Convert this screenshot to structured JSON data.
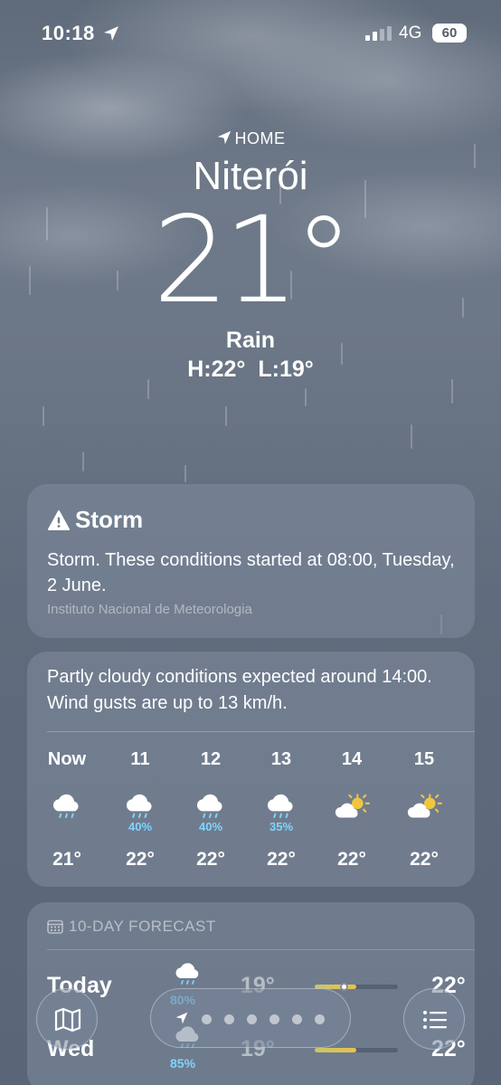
{
  "status_bar": {
    "time": "10:18",
    "network": "4G",
    "battery": "60"
  },
  "header": {
    "location_label": "HOME",
    "city": "Niterói",
    "temperature": "21°",
    "condition": "Rain",
    "high": "H:22°",
    "low": "L:19°"
  },
  "alert": {
    "title": "Storm",
    "text": "Storm. These conditions started at 08:00, Tuesday, 2 June.",
    "source": "Instituto Nacional de Meteorologia"
  },
  "hourly": {
    "summary": "Partly cloudy conditions expected around 14:00. Wind gusts are up to 13 km/h.",
    "hours": [
      {
        "label": "Now",
        "icon": "cloud-rain-icon",
        "pop": "",
        "temp": "21°"
      },
      {
        "label": "11",
        "icon": "cloud-rain-icon",
        "pop": "40%",
        "temp": "22°"
      },
      {
        "label": "12",
        "icon": "cloud-rain-icon",
        "pop": "40%",
        "temp": "22°"
      },
      {
        "label": "13",
        "icon": "cloud-rain-icon",
        "pop": "35%",
        "temp": "22°"
      },
      {
        "label": "14",
        "icon": "sun-cloud-icon",
        "pop": "",
        "temp": "22°"
      },
      {
        "label": "15",
        "icon": "sun-cloud-icon",
        "pop": "",
        "temp": "22°"
      }
    ]
  },
  "forecast": {
    "header": "10-DAY FORECAST",
    "days": [
      {
        "name": "Today",
        "icon": "cloud-rain-icon",
        "pop": "80%",
        "low": "19°",
        "high": "22°",
        "range_start": 0.0,
        "range_end": 0.5,
        "current": 0.35
      },
      {
        "name": "Wed",
        "icon": "cloud-rain-icon",
        "pop": "85%",
        "low": "19°",
        "high": "22°",
        "range_start": 0.0,
        "range_end": 0.5
      }
    ]
  },
  "toolbar": {
    "page_count": 6
  },
  "colors": {
    "precip": "#7fd3ff",
    "sun": "#f2c53d"
  }
}
